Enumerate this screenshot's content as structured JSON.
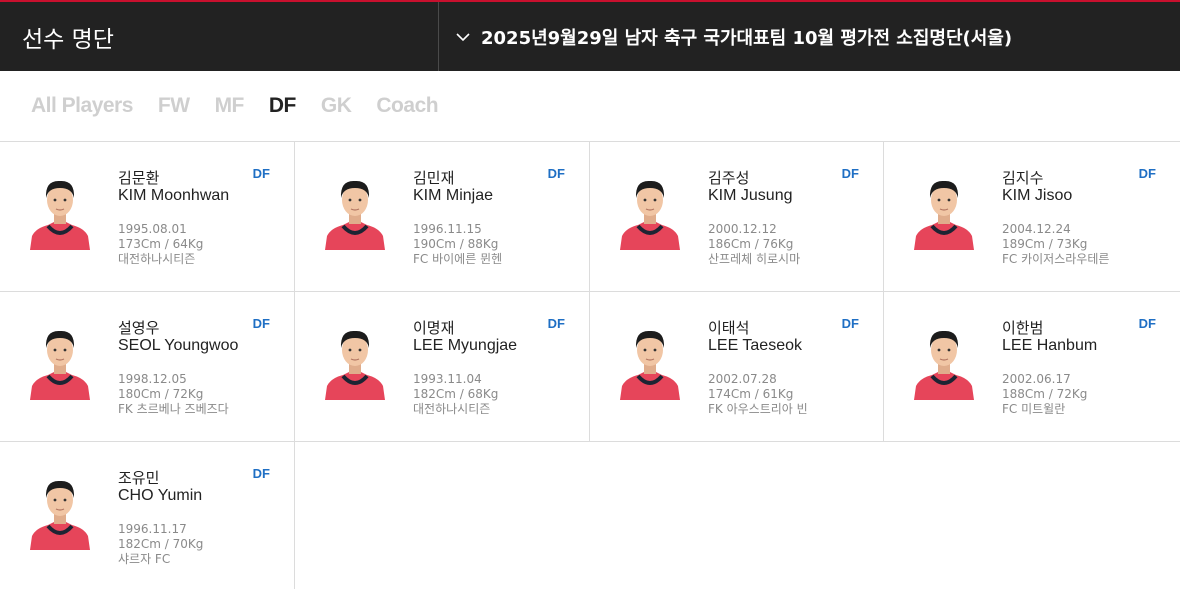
{
  "header": {
    "title": "선수 명단",
    "selected_event": "2025년9월29일 남자 축구 국가대표팀 10월 평가전 소집명단(서울)"
  },
  "tabs": [
    {
      "label": "All Players",
      "active": false
    },
    {
      "label": "FW",
      "active": false
    },
    {
      "label": "MF",
      "active": false
    },
    {
      "label": "DF",
      "active": true
    },
    {
      "label": "GK",
      "active": false
    },
    {
      "label": "Coach",
      "active": false
    }
  ],
  "colors": {
    "accent": "#c8102e",
    "position_label": "#1f6fc4",
    "header_bg": "#222222"
  },
  "players": [
    {
      "korean_name": "김문환",
      "english_name": "KIM Moonhwan",
      "position": "DF",
      "birth": "1995.08.01",
      "body": "173Cm / 64Kg",
      "club": "대전하나시티즌"
    },
    {
      "korean_name": "김민재",
      "english_name": "KIM Minjae",
      "position": "DF",
      "birth": "1996.11.15",
      "body": "190Cm / 88Kg",
      "club": "FC 바이에른 뮌헨"
    },
    {
      "korean_name": "김주성",
      "english_name": "KIM Jusung",
      "position": "DF",
      "birth": "2000.12.12",
      "body": "186Cm / 76Kg",
      "club": "산프레체 히로시마"
    },
    {
      "korean_name": "김지수",
      "english_name": "KIM Jisoo",
      "position": "DF",
      "birth": "2004.12.24",
      "body": "189Cm / 73Kg",
      "club": "FC 카이저스라우테른"
    },
    {
      "korean_name": "설영우",
      "english_name": "SEOL Youngwoo",
      "position": "DF",
      "birth": "1998.12.05",
      "body": "180Cm / 72Kg",
      "club": "FK 츠르베나 즈베즈다"
    },
    {
      "korean_name": "이명재",
      "english_name": "LEE Myungjae",
      "position": "DF",
      "birth": "1993.11.04",
      "body": "182Cm / 68Kg",
      "club": "대전하나시티즌"
    },
    {
      "korean_name": "이태석",
      "english_name": "LEE Taeseok",
      "position": "DF",
      "birth": "2002.07.28",
      "body": "174Cm / 61Kg",
      "club": "FK 아우스트리아 빈"
    },
    {
      "korean_name": "이한범",
      "english_name": "LEE Hanbum",
      "position": "DF",
      "birth": "2002.06.17",
      "body": "188Cm / 72Kg",
      "club": "FC 미트윌란"
    },
    {
      "korean_name": "조유민",
      "english_name": "CHO Yumin",
      "position": "DF",
      "birth": "1996.11.17",
      "body": "182Cm / 70Kg",
      "club": "샤르자 FC"
    }
  ]
}
